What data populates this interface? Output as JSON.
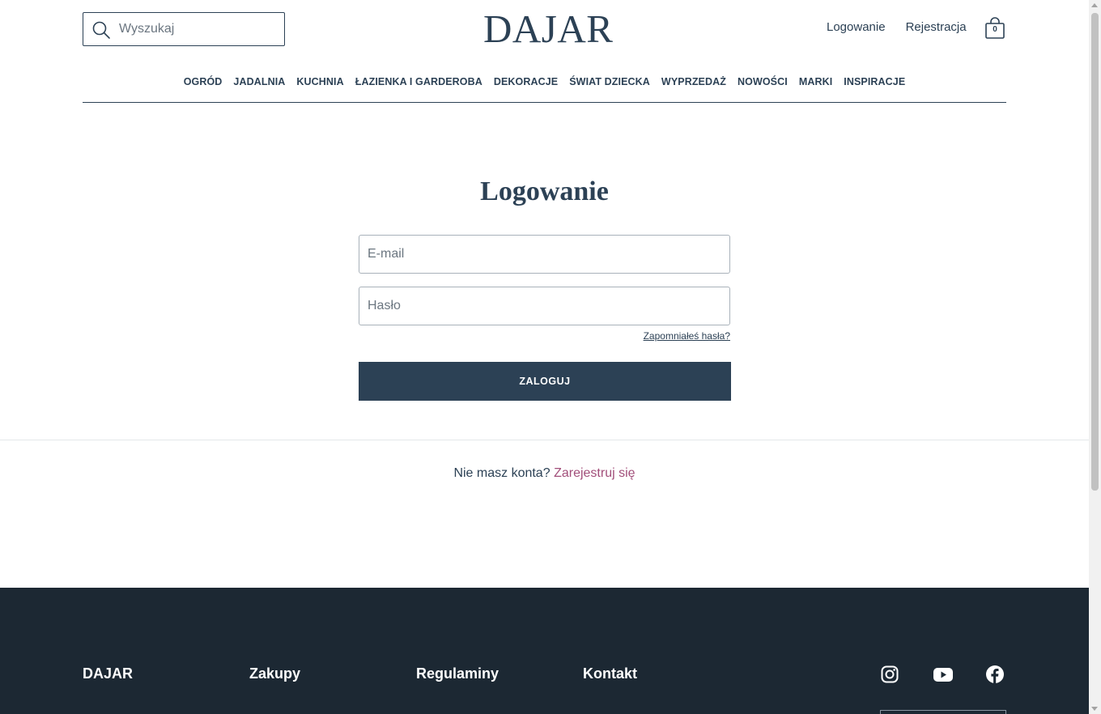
{
  "header": {
    "search_placeholder": "Wyszukaj",
    "logo": "DAJAR",
    "login_link": "Logowanie",
    "register_link": "Rejestracja",
    "cart_count": "0"
  },
  "nav": {
    "items": [
      {
        "label": "OGRÓD"
      },
      {
        "label": "JADALNIA"
      },
      {
        "label": "KUCHNIA"
      },
      {
        "label": "ŁAZIENKA I GARDEROBA"
      },
      {
        "label": "DEKORACJE"
      },
      {
        "label": "ŚWIAT DZIECKA"
      },
      {
        "label": "WYPRZEDAŻ"
      },
      {
        "label": "NOWOŚCI"
      },
      {
        "label": "MARKI"
      },
      {
        "label": "INSPIRACJE"
      }
    ]
  },
  "login": {
    "title": "Logowanie",
    "email_placeholder": "E-mail",
    "password_placeholder": "Hasło",
    "forgot_password": "Zapomniałeś hasła?",
    "submit_label": "ZALOGUJ",
    "no_account_text": "Nie masz konta?",
    "register_cta": "Zarejestruj się"
  },
  "footer": {
    "headings": [
      "DAJAR",
      "Zakupy",
      "Regulaminy",
      "Kontakt"
    ],
    "social": [
      "instagram-icon",
      "youtube-icon",
      "facebook-icon"
    ]
  },
  "colors": {
    "primary": "#2c4155",
    "accent_link": "#a24f7a",
    "footer_bg": "#1c2833"
  }
}
